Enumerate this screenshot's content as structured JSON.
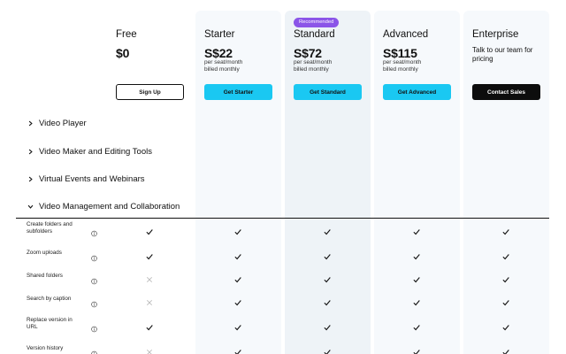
{
  "plans": [
    {
      "name": "Free",
      "price": "$0",
      "sub": "",
      "cta": "Sign Up",
      "style": "outline"
    },
    {
      "name": "Starter",
      "price": "S$22",
      "sub": "per seat/month\nbilled monthly",
      "cta": "Get Starter",
      "style": "cyan"
    },
    {
      "name": "Standard",
      "price": "S$72",
      "sub": "per seat/month\nbilled monthly",
      "cta": "Get Standard",
      "style": "cyan",
      "badge": "Recommended"
    },
    {
      "name": "Advanced",
      "price": "S$115",
      "sub": "per seat/month\nbilled monthly",
      "cta": "Get Advanced",
      "style": "cyan"
    },
    {
      "name": "Enterprise",
      "contact": "Talk to our team for pricing",
      "cta": "Contact Sales",
      "style": "dark"
    }
  ],
  "sections": [
    {
      "title": "Video Player",
      "open": false
    },
    {
      "title": "Video Maker and Editing Tools",
      "open": false
    },
    {
      "title": "Virtual Events and Webinars",
      "open": false
    },
    {
      "title": "Video Management and Collaboration",
      "open": true
    }
  ],
  "features": [
    {
      "label": "Create folders and subfolders",
      "values": [
        true,
        true,
        true,
        true,
        true
      ]
    },
    {
      "label": "Zoom uploads",
      "values": [
        true,
        true,
        true,
        true,
        true
      ]
    },
    {
      "label": "Shared folders",
      "values": [
        false,
        true,
        true,
        true,
        true
      ]
    },
    {
      "label": "Search by caption",
      "values": [
        false,
        true,
        true,
        true,
        true
      ]
    },
    {
      "label": "Replace version in URL",
      "values": [
        true,
        true,
        true,
        true,
        true
      ]
    },
    {
      "label": "Version history",
      "values": [
        false,
        true,
        true,
        true,
        true
      ]
    }
  ],
  "colors": {
    "accent": "#1ac8f2",
    "badge": "#8b55e8",
    "dark": "#0d0d0d"
  },
  "icons": {
    "collapsed": "chevron-right-icon",
    "expanded": "chevron-down-icon",
    "info": "info-icon",
    "check": "check-icon",
    "cross": "cross-icon"
  }
}
